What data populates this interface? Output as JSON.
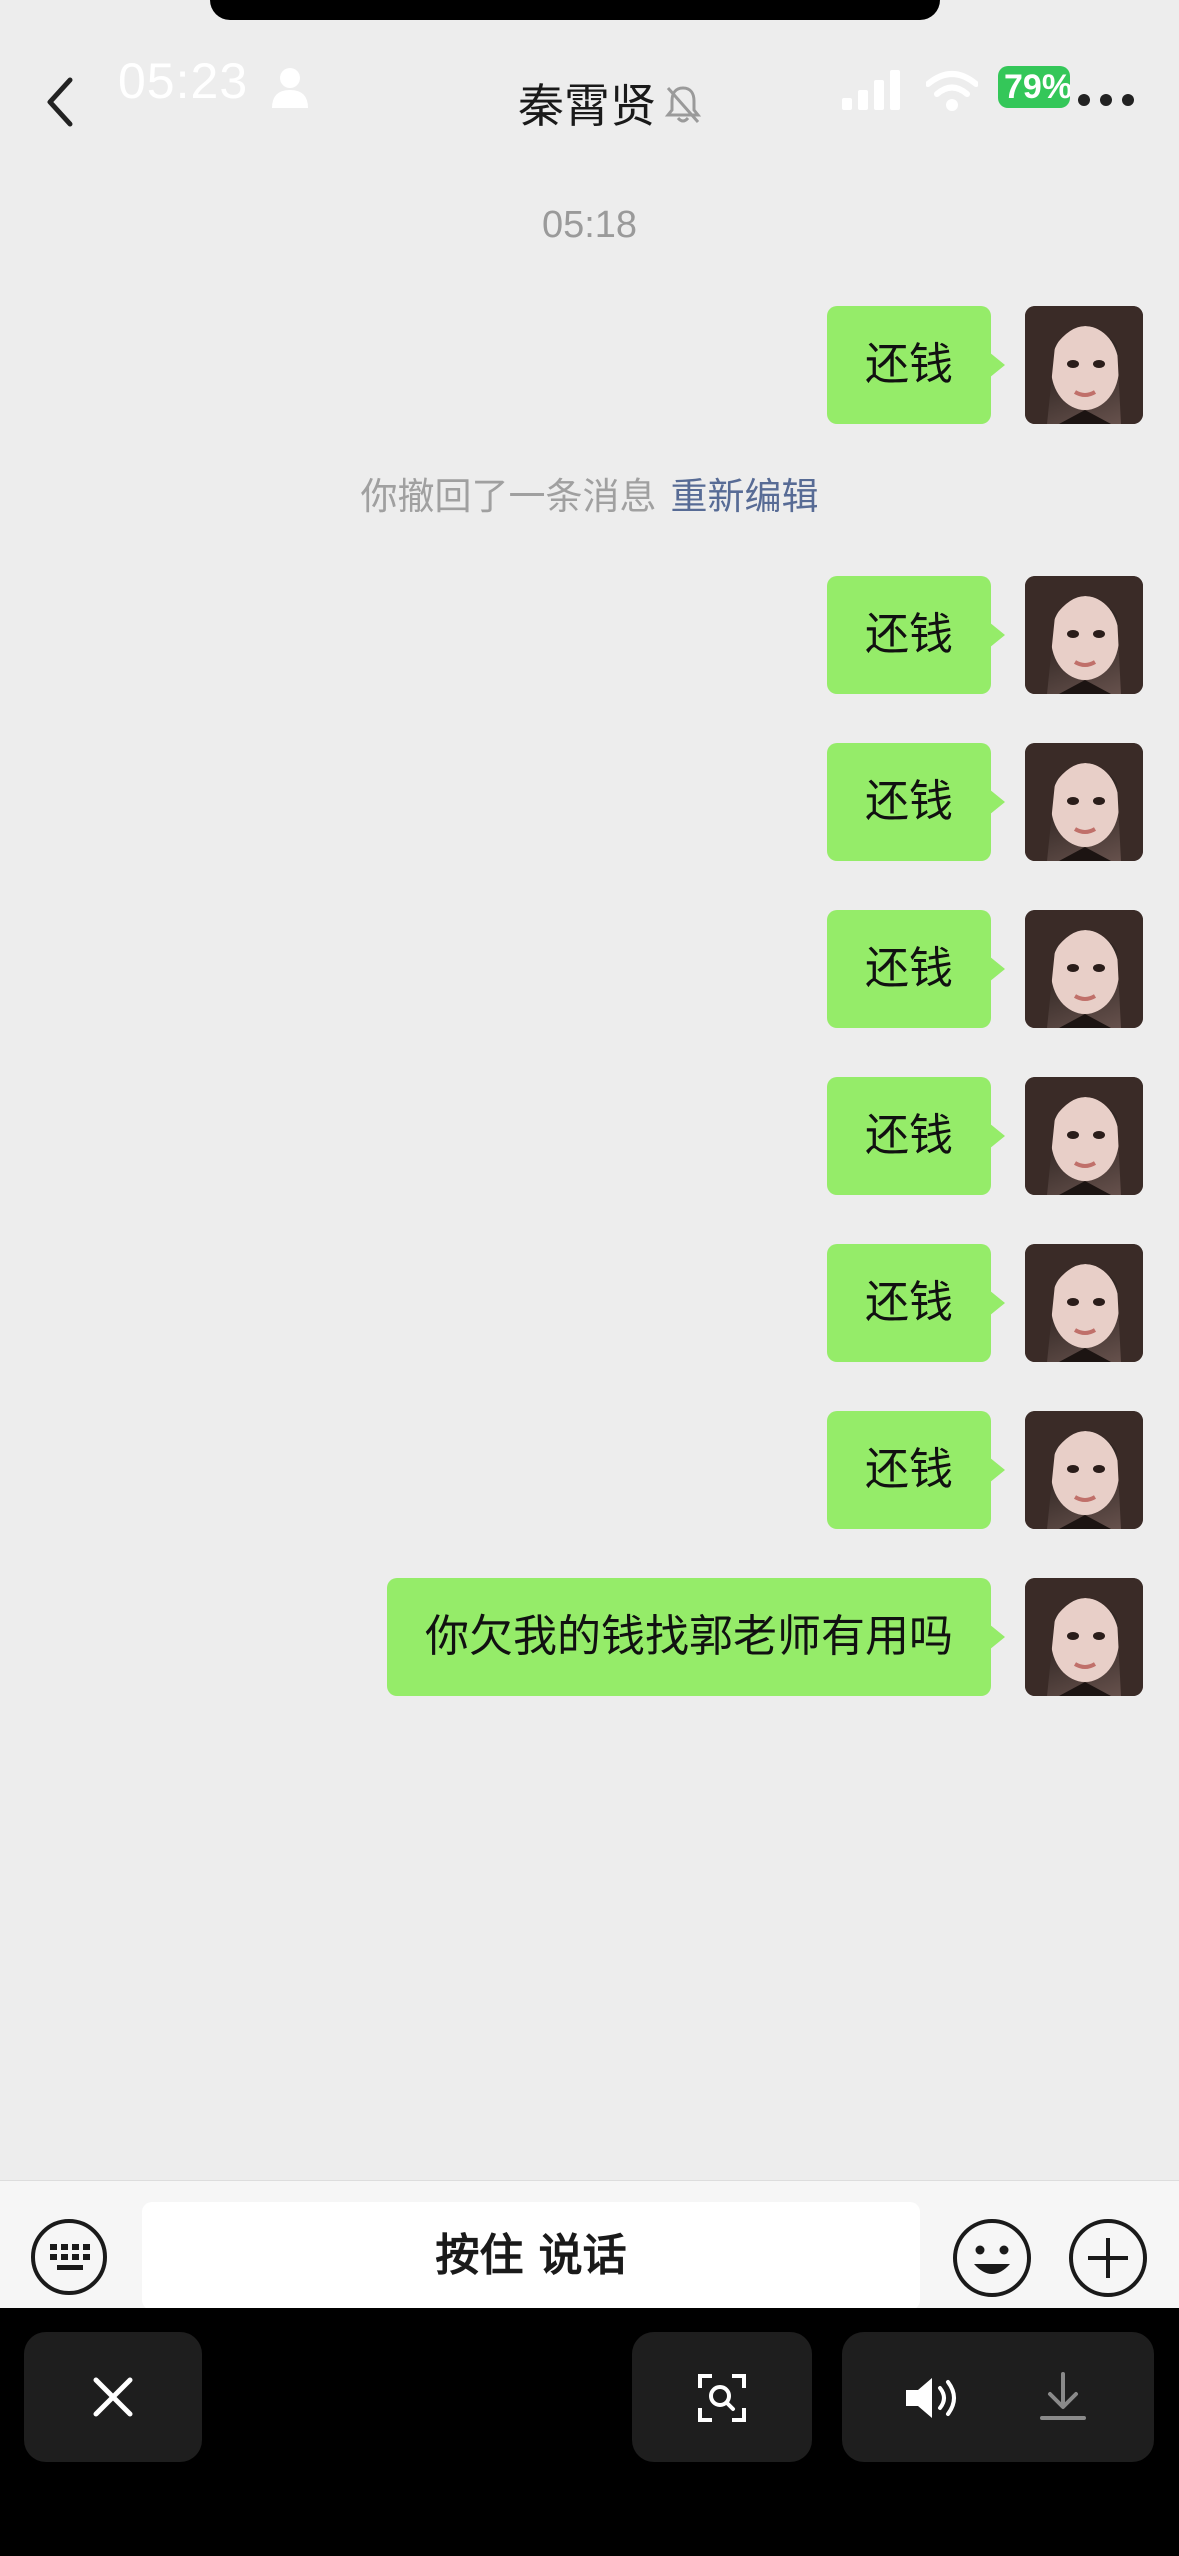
{
  "status_bar": {
    "time": "05:23",
    "battery": "79%"
  },
  "header": {
    "title": "秦霄贤",
    "icons": [
      "back-icon",
      "person-icon",
      "mute-bell-icon",
      "signal-icon",
      "wifi-icon",
      "more-icon"
    ]
  },
  "messages": {
    "timestamp": "05:18",
    "recall_notice": "你撤回了一条消息",
    "recall_action": "重新编辑",
    "items": [
      {
        "text": "还钱",
        "sender": "me"
      },
      {
        "text": "还钱",
        "sender": "me"
      },
      {
        "text": "还钱",
        "sender": "me"
      },
      {
        "text": "还钱",
        "sender": "me"
      },
      {
        "text": "还钱",
        "sender": "me"
      },
      {
        "text": "还钱",
        "sender": "me"
      },
      {
        "text": "还钱",
        "sender": "me"
      },
      {
        "text": "你欠我的钱找郭老师有用吗",
        "sender": "me"
      }
    ]
  },
  "input_bar": {
    "voice_button_label": "按住 说话",
    "icons": [
      "keyboard-icon",
      "emoji-icon",
      "plus-icon"
    ]
  },
  "system_bar": {
    "icons": [
      "close-icon",
      "scan-icon",
      "speaker-icon",
      "download-icon"
    ]
  },
  "colors": {
    "bubble_mine": "#95ec69",
    "background": "#ededed",
    "link": "#576b95",
    "battery": "#34c759"
  }
}
